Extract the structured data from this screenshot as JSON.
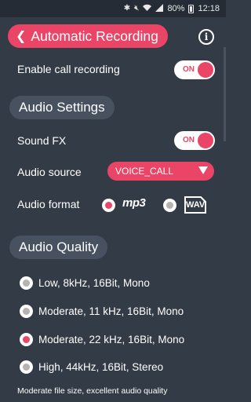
{
  "status_bar": {
    "battery": "80%",
    "time": "12:18",
    "icons": [
      "bluetooth-icon",
      "mute-icon",
      "wifi-icon",
      "signal-icon",
      "battery-icon"
    ]
  },
  "header": {
    "title": "Automatic Recording",
    "back_icon": "chevron-left-icon",
    "info_icon": "info-icon",
    "info_glyph": "i"
  },
  "enable_call_recording": {
    "label": "Enable call recording",
    "toggle_text": "ON"
  },
  "audio_settings": {
    "section_title": "Audio Settings",
    "sound_fx": {
      "label": "Sound FX",
      "toggle_text": "ON"
    },
    "audio_source": {
      "label": "Audio source",
      "selected": "VOICE_CALL"
    },
    "audio_format": {
      "label": "Audio format",
      "options": [
        {
          "logo_text": "mp3",
          "selected": true
        },
        {
          "logo_text": "WAV",
          "selected": false
        }
      ]
    }
  },
  "audio_quality": {
    "section_title": "Audio Quality",
    "options": [
      {
        "label": "Low, 8kHz, 16Bit, Mono",
        "selected": false
      },
      {
        "label": "Moderate, 11 kHz, 16Bit, Mono",
        "selected": false
      },
      {
        "label": "Moderate, 22 kHz, 16Bit, Mono",
        "selected": true
      },
      {
        "label": "High, 44kHz, 16Bit, Stereo",
        "selected": false
      }
    ],
    "note": "Moderate file size, excellent audio quality"
  },
  "colors": {
    "background": "#333b46",
    "accent": "#ea4467",
    "section_pill": "#485160",
    "status_bar": "#262c35"
  }
}
